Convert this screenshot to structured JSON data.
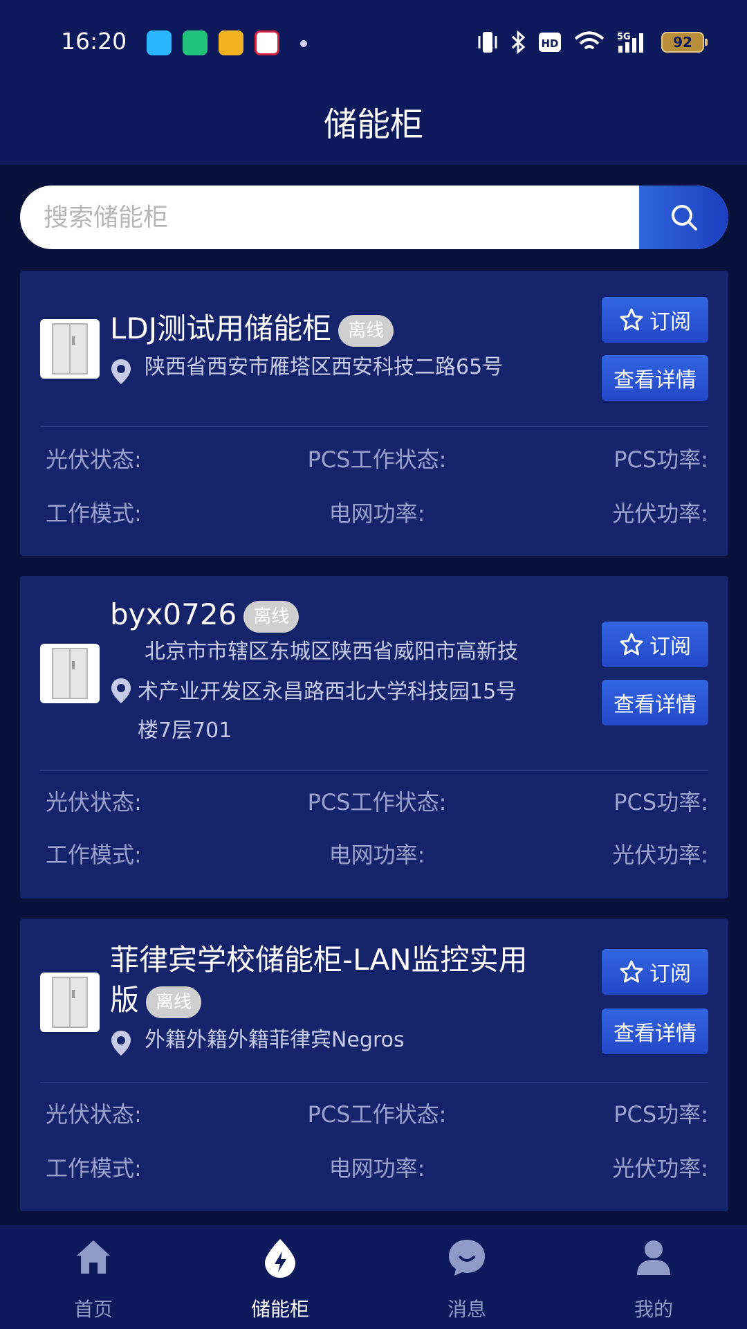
{
  "status_bar": {
    "time": "16:20",
    "battery": "92"
  },
  "header": {
    "title": "储能柜"
  },
  "search": {
    "placeholder": "搜索储能柜"
  },
  "cards": [
    {
      "name": "LDJ测试用储能柜",
      "status": "离线",
      "address": "陕西省西安市雁塔区西安科技二路65号",
      "subscribe_label": "订阅",
      "detail_label": "查看详情",
      "fields": [
        "光伏状态:",
        "PCS工作状态:",
        "PCS功率:",
        "工作模式:",
        "电网功率:",
        "光伏功率:"
      ]
    },
    {
      "name": "byx0726",
      "status": "离线",
      "address_lines": [
        "北京市市辖区东城区陕西省威阳市高新技",
        "术产业开发区永昌路西北大学科技园15号",
        "楼7层701"
      ],
      "subscribe_label": "订阅",
      "detail_label": "查看详情",
      "fields": [
        "光伏状态:",
        "PCS工作状态:",
        "PCS功率:",
        "工作模式:",
        "电网功率:",
        "光伏功率:"
      ]
    },
    {
      "name_lines": [
        "菲律宾学校储能柜-LAN监控实用",
        "版"
      ],
      "status": "离线",
      "address": "外籍外籍外籍菲律宾Negros",
      "subscribe_label": "订阅",
      "detail_label": "查看详情",
      "fields": [
        "光伏状态:",
        "PCS工作状态:",
        "PCS功率:",
        "工作模式:",
        "电网功率:",
        "光伏功率:"
      ]
    }
  ],
  "bottom_nav": [
    {
      "label": "首页",
      "icon": "home-icon",
      "active": false
    },
    {
      "label": "储能柜",
      "icon": "lightning-icon",
      "active": true
    },
    {
      "label": "消息",
      "icon": "chat-icon",
      "active": false
    },
    {
      "label": "我的",
      "icon": "user-icon",
      "active": false
    }
  ],
  "colors": {
    "background": "#07113a",
    "header": "#0c1a5c",
    "card": "#15236a",
    "accent": "#2a56d8",
    "badge": "#cfcfcf"
  }
}
